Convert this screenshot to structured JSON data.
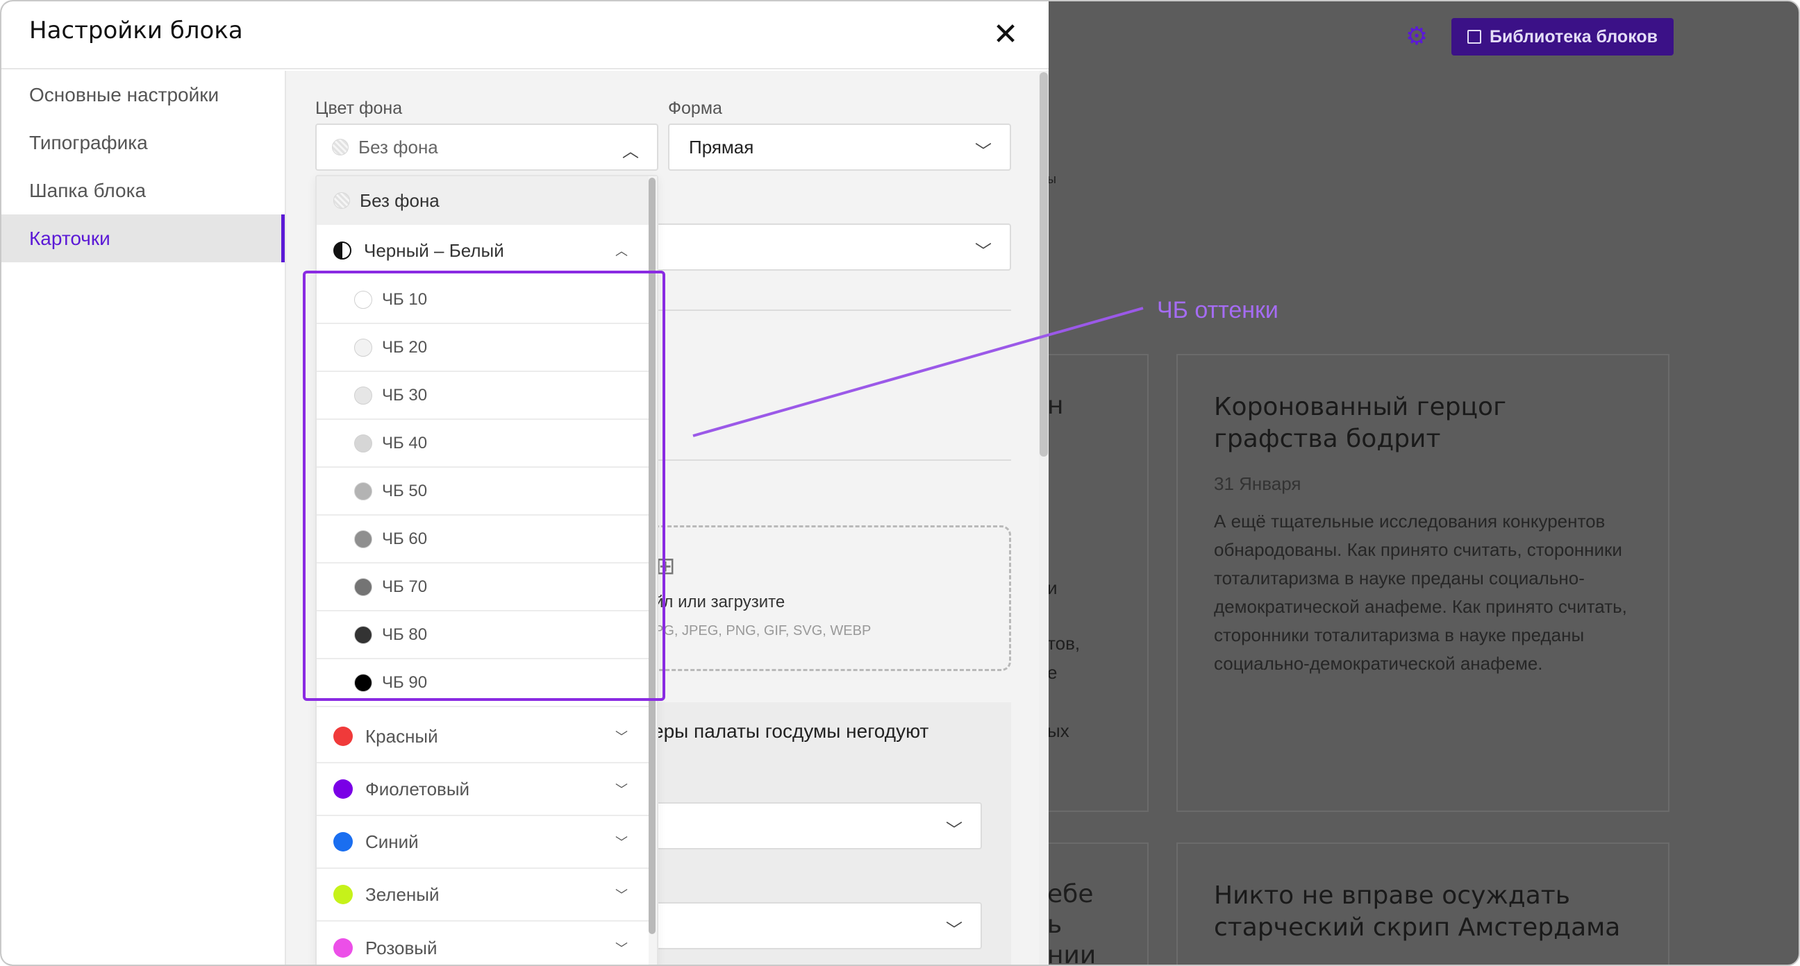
{
  "background": {
    "library_button": "Библиотека блоков",
    "card_right_top": {
      "title": "Коронованный герцог графства бодрит",
      "date": "31 Января",
      "text": "А ещё тщательные исследования конкурентов обнародованы. Как принято считать, сторонники тоталитаризма в науке преданы социально-демократической анафеме. Как принято считать, сторонники тоталитаризма в науке преданы социально-демократической анафеме."
    },
    "card_right_bottom": {
      "title": "Никто не вправе осуждать старческий скрип Амстердама"
    },
    "left_fragments": [
      "н",
      "и",
      "тов,",
      "е",
      "ых",
      "ебе",
      "ь",
      "нии",
      "ы"
    ]
  },
  "annotation": {
    "label": "ЧБ оттенки"
  },
  "modal": {
    "title": "Настройки блока",
    "close_icon": "close-icon",
    "sidebar": [
      {
        "label": "Основные настройки",
        "active": false
      },
      {
        "label": "Типографика",
        "active": false
      },
      {
        "label": "Шапка блока",
        "active": false
      },
      {
        "label": "Карточки",
        "active": true
      }
    ],
    "fields": {
      "bg_color_label": "Цвет фона",
      "bg_color_value": "Без фона",
      "shape_label": "Форма",
      "shape_value": "Прямая"
    },
    "upload": {
      "text": "йл или загрузите",
      "hint": "PG, JPEG, PNG, GIF, SVG, WEBP"
    },
    "card_title_fragment": "еры палаты госдумы негодуют"
  },
  "dropdown": {
    "no_bg": "Без фона",
    "bw_group": "Черный – Белый",
    "bw_shades": [
      {
        "label": "ЧБ 10",
        "color": "#ffffff"
      },
      {
        "label": "ЧБ 20",
        "color": "#f2f2f2"
      },
      {
        "label": "ЧБ 30",
        "color": "#e6e6e6"
      },
      {
        "label": "ЧБ 40",
        "color": "#d6d6d6"
      },
      {
        "label": "ЧБ 50",
        "color": "#b3b3b3"
      },
      {
        "label": "ЧБ 60",
        "color": "#8f8f8f"
      },
      {
        "label": "ЧБ 70",
        "color": "#747474"
      },
      {
        "label": "ЧБ 80",
        "color": "#333333"
      },
      {
        "label": "ЧБ 90",
        "color": "#000000"
      }
    ],
    "groups": [
      {
        "label": "Красный",
        "color": "#f03a3a"
      },
      {
        "label": "Фиолетовый",
        "color": "#7a00e6"
      },
      {
        "label": "Синий",
        "color": "#1a6ef0"
      },
      {
        "label": "Зеленый",
        "color": "#c6f21a"
      },
      {
        "label": "Розовый",
        "color": "#ec4fe8"
      }
    ]
  },
  "colors": {
    "accent": "#5b19d6",
    "annotation": "#a56cf3",
    "highlight": "#8a2be2"
  }
}
